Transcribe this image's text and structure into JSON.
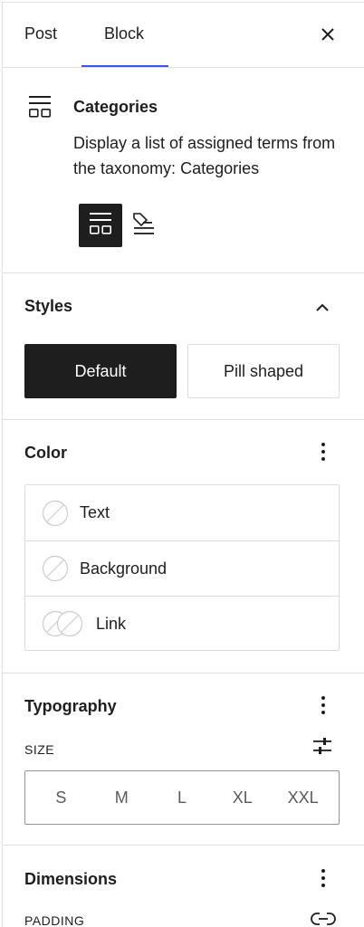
{
  "tabs": [
    {
      "label": "Post"
    },
    {
      "label": "Block"
    }
  ],
  "block": {
    "title": "Categories",
    "description": "Display a list of assigned terms from the taxonomy: Categories"
  },
  "styles": {
    "title": "Styles",
    "options": [
      {
        "label": "Default",
        "selected": true
      },
      {
        "label": "Pill shaped",
        "selected": false
      }
    ]
  },
  "color": {
    "title": "Color",
    "items": [
      {
        "label": "Text"
      },
      {
        "label": "Background"
      },
      {
        "label": "Link"
      }
    ]
  },
  "typography": {
    "title": "Typography",
    "size_label": "SIZE",
    "sizes": [
      "S",
      "M",
      "L",
      "XL",
      "XXL"
    ]
  },
  "dimensions": {
    "title": "Dimensions",
    "padding_label": "PADDING"
  },
  "colors": {
    "accent": "#3858e9",
    "dark": "#1e1e1e",
    "border": "#dddddd"
  }
}
